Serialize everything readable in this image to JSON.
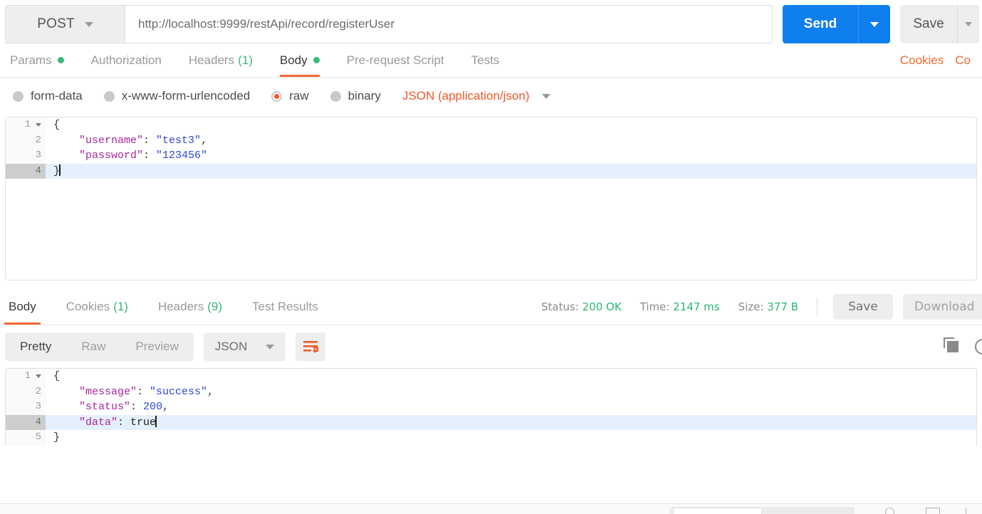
{
  "request": {
    "method": "POST",
    "url": "http://localhost:9999/restApi/record/registerUser",
    "send_label": "Send",
    "save_label": "Save",
    "tabs": [
      {
        "label": "Params",
        "badge_dot": true,
        "active": false
      },
      {
        "label": "Authorization",
        "active": false
      },
      {
        "label": "Headers",
        "count": "(1)",
        "active": false
      },
      {
        "label": "Body",
        "badge_dot": true,
        "active": true
      },
      {
        "label": "Pre-request Script",
        "active": false
      },
      {
        "label": "Tests",
        "active": false
      }
    ],
    "right_links": [
      "Cookies",
      "Co"
    ],
    "body_types": [
      {
        "label": "form-data",
        "selected": false
      },
      {
        "label": "x-www-form-urlencoded",
        "selected": false
      },
      {
        "label": "raw",
        "selected": true
      },
      {
        "label": "binary",
        "selected": false
      }
    ],
    "content_type": "JSON (application/json)",
    "body_lines": [
      {
        "num": "1",
        "fold": true,
        "active": false,
        "tokens": [
          {
            "t": "{",
            "c": "k-pun"
          }
        ]
      },
      {
        "num": "2",
        "fold": false,
        "active": false,
        "tokens": [
          {
            "t": "    ",
            "c": "k-pun"
          },
          {
            "t": "\"username\"",
            "c": "k-key"
          },
          {
            "t": ": ",
            "c": "k-pun"
          },
          {
            "t": "\"test3\"",
            "c": "k-str"
          },
          {
            "t": ",",
            "c": "k-pun"
          }
        ]
      },
      {
        "num": "3",
        "fold": false,
        "active": false,
        "tokens": [
          {
            "t": "    ",
            "c": "k-pun"
          },
          {
            "t": "\"password\"",
            "c": "k-key"
          },
          {
            "t": ": ",
            "c": "k-pun"
          },
          {
            "t": "\"123456\"",
            "c": "k-str"
          }
        ]
      },
      {
        "num": "4",
        "fold": false,
        "active": true,
        "cursor": true,
        "tokens": [
          {
            "t": "}",
            "c": "k-pun"
          }
        ]
      }
    ]
  },
  "response": {
    "tabs": [
      {
        "label": "Body",
        "active": true
      },
      {
        "label": "Cookies",
        "count": "(1)",
        "active": false
      },
      {
        "label": "Headers",
        "count": "(9)",
        "active": false
      },
      {
        "label": "Test Results",
        "active": false
      }
    ],
    "status_label": "Status:",
    "status_value": "200 OK",
    "time_label": "Time:",
    "time_value": "2147 ms",
    "size_label": "Size:",
    "size_value": "377 B",
    "save_label": "Save",
    "download_label": "Download",
    "view_modes": [
      {
        "label": "Pretty",
        "active": true
      },
      {
        "label": "Raw",
        "active": false
      },
      {
        "label": "Preview",
        "active": false
      }
    ],
    "format": "JSON",
    "body_lines": [
      {
        "num": "1",
        "fold": true,
        "active": false,
        "tokens": [
          {
            "t": "{",
            "c": "k-pun"
          }
        ]
      },
      {
        "num": "2",
        "fold": false,
        "active": false,
        "tokens": [
          {
            "t": "    ",
            "c": "k-pun"
          },
          {
            "t": "\"message\"",
            "c": "k-key"
          },
          {
            "t": ": ",
            "c": "k-pun"
          },
          {
            "t": "\"success\"",
            "c": "k-str"
          },
          {
            "t": ",",
            "c": "k-pun"
          }
        ]
      },
      {
        "num": "3",
        "fold": false,
        "active": false,
        "tokens": [
          {
            "t": "    ",
            "c": "k-pun"
          },
          {
            "t": "\"status\"",
            "c": "k-key"
          },
          {
            "t": ": ",
            "c": "k-pun"
          },
          {
            "t": "200",
            "c": "k-num"
          },
          {
            "t": ",",
            "c": "k-pun"
          }
        ]
      },
      {
        "num": "4",
        "fold": false,
        "active": true,
        "cursor": true,
        "tokens": [
          {
            "t": "    ",
            "c": "k-pun"
          },
          {
            "t": "\"data\"",
            "c": "k-key"
          },
          {
            "t": ": ",
            "c": "k-pun"
          },
          {
            "t": "true",
            "c": "k-lit"
          }
        ]
      },
      {
        "num": "5",
        "fold": false,
        "active": false,
        "tokens": [
          {
            "t": "}",
            "c": "k-pun"
          }
        ]
      }
    ]
  },
  "colors": {
    "accent_orange": "#f06a35",
    "send_blue": "#0f7ff0",
    "status_green": "#2bb673",
    "dot_green": "#3cb878"
  }
}
